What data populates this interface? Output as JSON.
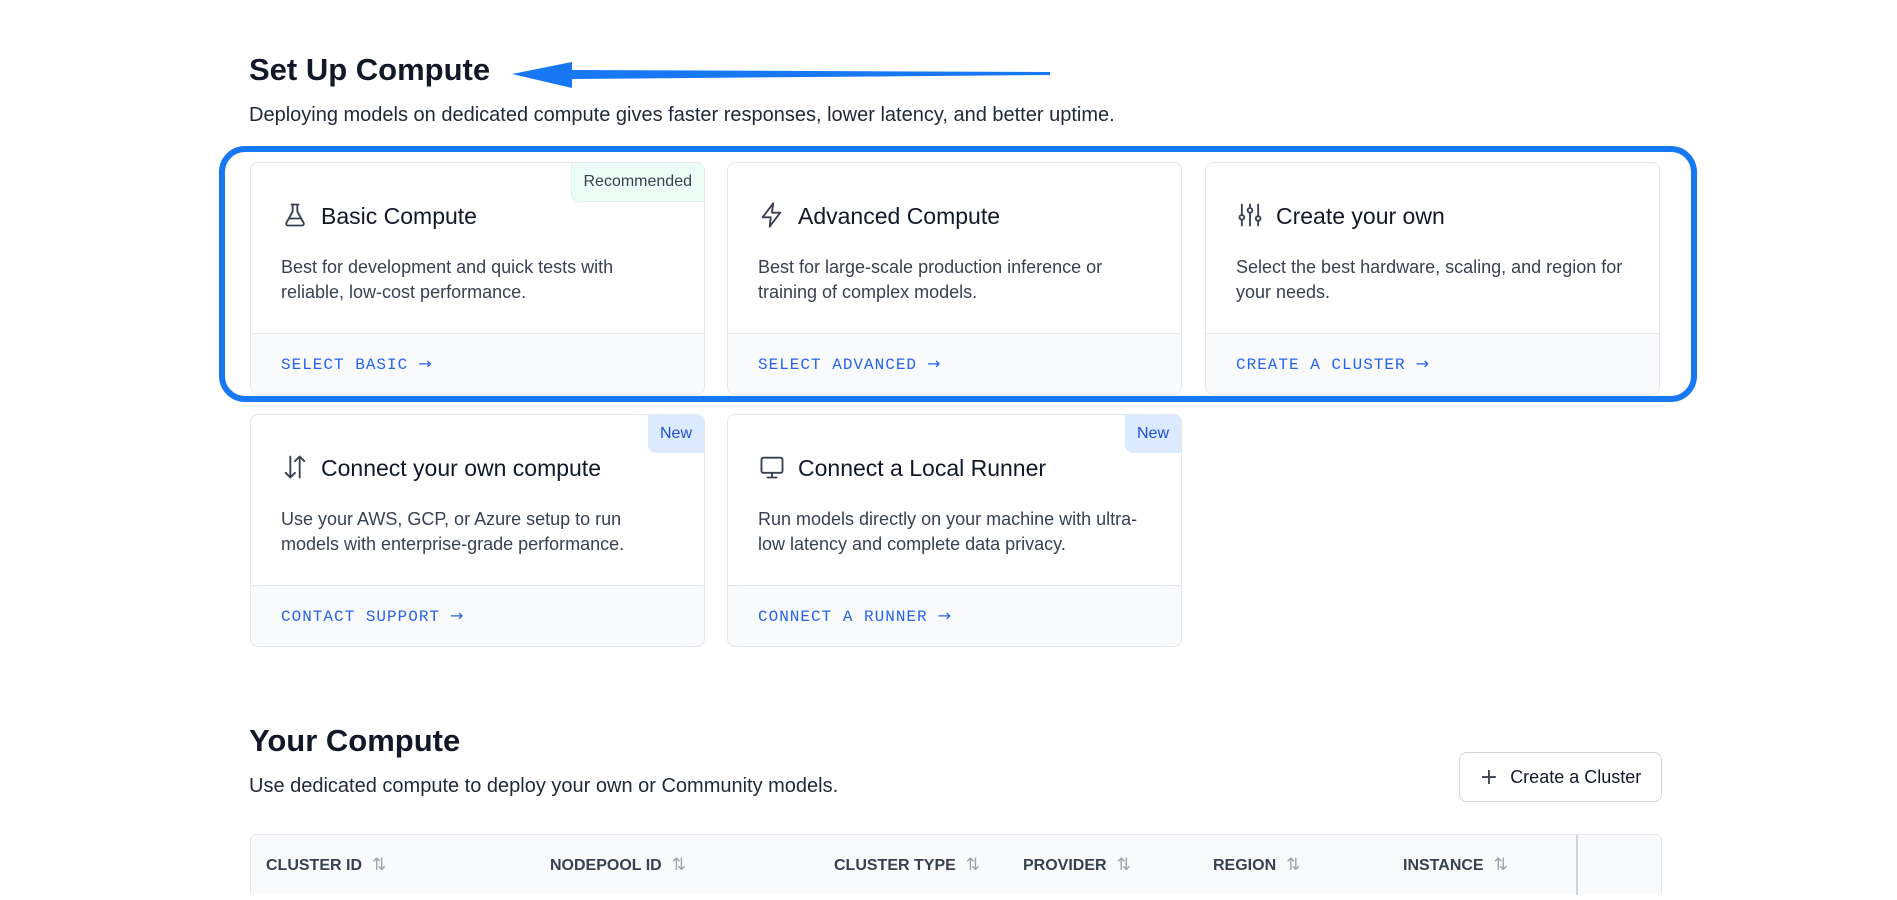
{
  "setup": {
    "title": "Set Up Compute",
    "subtitle": "Deploying models on dedicated compute gives faster responses, lower latency, and better uptime."
  },
  "cards": [
    {
      "icon": "flask-icon",
      "title": "Basic Compute",
      "desc": "Best for development and quick tests with reliable, low-cost performance.",
      "link": "SELECT BASIC",
      "badge": "Recommended"
    },
    {
      "icon": "lightning-icon",
      "title": "Advanced Compute",
      "desc": "Best for large-scale production inference or training of complex models.",
      "link": "SELECT ADVANCED"
    },
    {
      "icon": "sliders-icon",
      "title": "Create your own",
      "desc": "Select the best hardware, scaling, and region for your needs.",
      "link": "CREATE A CLUSTER"
    },
    {
      "icon": "transfer-arrows-icon",
      "title": "Connect your own compute",
      "desc": "Use your AWS, GCP, or Azure setup to run models with enterprise-grade performance.",
      "link": "CONTACT SUPPORT",
      "badge": "New"
    },
    {
      "icon": "monitor-icon",
      "title": "Connect a Local Runner",
      "desc": "Run models directly on your machine with ultra-low latency and complete data privacy.",
      "link": "CONNECT A RUNNER",
      "badge": "New"
    }
  ],
  "your_compute": {
    "title": "Your Compute",
    "subtitle": "Use dedicated compute to deploy your own or Community models.",
    "create_button": "Create a Cluster"
  },
  "table": {
    "columns": [
      "CLUSTER ID",
      "NODEPOOL ID",
      "CLUSTER TYPE",
      "PROVIDER",
      "REGION",
      "INSTANCE"
    ]
  },
  "colors": {
    "accent": "#2563eb",
    "annotation": "#1877f2",
    "recommended_bg": "#ecfdf5",
    "new_bg": "#dbeafe"
  }
}
